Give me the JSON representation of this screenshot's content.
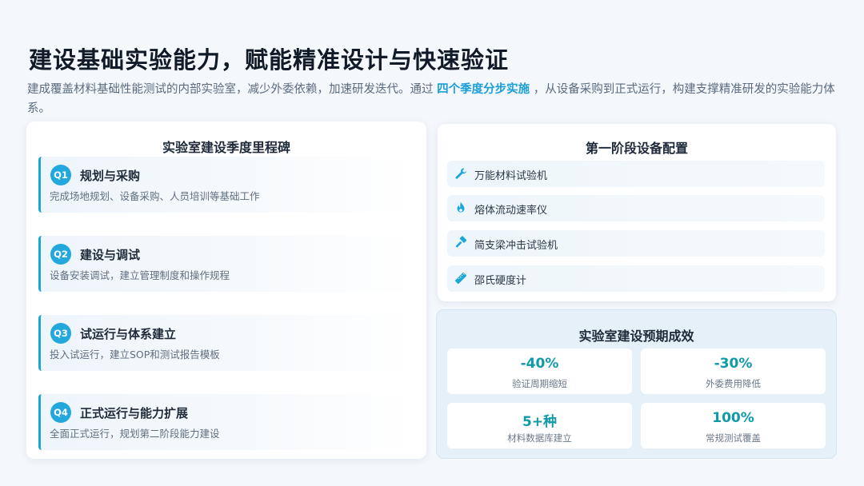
{
  "header": {
    "title": "建设基础实验能力，赋能精准设计与快速验证",
    "intro_before": "建成覆盖材料基础性能测试的内部实验室，减少外委依赖，加速研发迭代。通过 ",
    "intro_highlight": "四个季度分步实施",
    "intro_after": " ，从设备采购到正式运行，构建支撑精准研发的实验能力体系。"
  },
  "milestones": {
    "title": "实验室建设季度里程碑",
    "items": [
      {
        "badge": "Q1",
        "title": "规划与采购",
        "desc": "完成场地规划、设备采购、人员培训等基础工作"
      },
      {
        "badge": "Q2",
        "title": "建设与调试",
        "desc": "设备安装调试，建立管理制度和操作规程"
      },
      {
        "badge": "Q3",
        "title": "试运行与体系建立",
        "desc": "投入试运行，建立SOP和测试报告模板"
      },
      {
        "badge": "Q4",
        "title": "正式运行与能力扩展",
        "desc": "全面正式运行，规划第二阶段能力建设"
      }
    ]
  },
  "equipment": {
    "title": "第一阶段设备配置",
    "items": [
      {
        "icon": "wrench-icon",
        "label": "万能材料试验机"
      },
      {
        "icon": "flame-icon",
        "label": "熔体流动速率仪"
      },
      {
        "icon": "hammer-icon",
        "label": "简支梁冲击试验机"
      },
      {
        "icon": "ruler-icon",
        "label": "邵氏硬度计"
      }
    ]
  },
  "results": {
    "title": "实验室建设预期成效",
    "items": [
      {
        "value": "-40%",
        "label": "验证周期缩短"
      },
      {
        "value": "-30%",
        "label": "外委费用降低"
      },
      {
        "value": "5+种",
        "label": "材料数据库建立"
      },
      {
        "value": "100%",
        "label": "常规测试覆盖"
      }
    ]
  },
  "colors": {
    "accent": "#1aa7d8",
    "result_value": "#0f9aa8",
    "highlight_text": "#1b9fd6"
  }
}
